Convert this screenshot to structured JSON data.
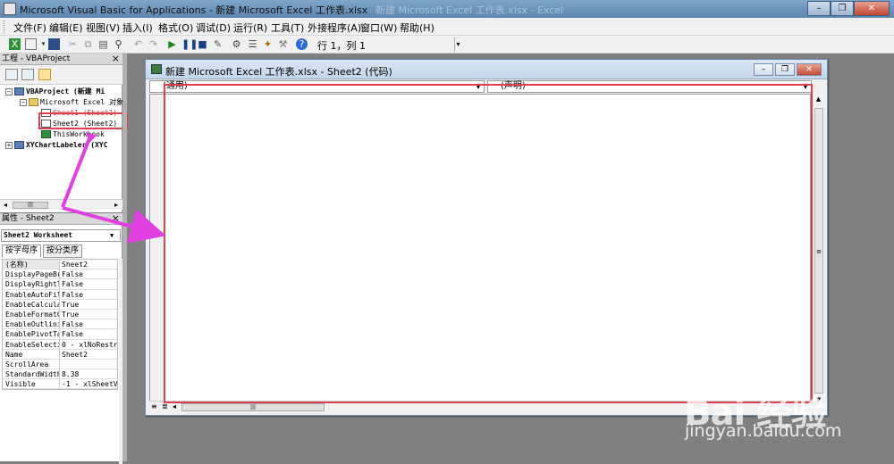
{
  "window": {
    "title": "Microsoft Visual Basic for Applications - 新建 Microsoft Excel 工作表.xlsx",
    "ghost_title": "新建 Microsoft Excel 工作表.xlsx - Excel"
  },
  "menubar": {
    "items": [
      "文件(F)",
      "编辑(E)",
      "视图(V)",
      "插入(I)",
      "格式(O)",
      "调试(D)",
      "运行(R)",
      "工具(T)",
      "外接程序(A)",
      "窗口(W)",
      "帮助(H)"
    ]
  },
  "toolbar": {
    "status": "行 1，列 1"
  },
  "project_pane": {
    "header": "工程 - VBAProject",
    "close": "×",
    "tree": [
      {
        "label": "VBAProject (新建 Mi",
        "bold": true
      },
      {
        "label": "Microsoft Excel 对象"
      },
      {
        "label": "Sheet1 (Sheet1)"
      },
      {
        "label": "Sheet2 (Sheet2)"
      },
      {
        "label": "ThisWorkbook"
      },
      {
        "label": "XYChartLabeler (XYC",
        "bold": true
      }
    ]
  },
  "properties_pane": {
    "header": "属性 - Sheet2",
    "close": "×",
    "object": "Sheet2 Worksheet",
    "tabs": [
      "按字母序",
      "按分类序"
    ],
    "rows": [
      {
        "key": "(名称)",
        "value": "Sheet2"
      },
      {
        "key": "DisplayPageBre",
        "value": "False"
      },
      {
        "key": "DisplayRightTo",
        "value": "False"
      },
      {
        "key": "EnableAutoFilt",
        "value": "False"
      },
      {
        "key": "EnableCalculat",
        "value": "True"
      },
      {
        "key": "EnableFormatCo",
        "value": "True"
      },
      {
        "key": "EnableOutlinin",
        "value": "False"
      },
      {
        "key": "EnablePivotTab",
        "value": "False"
      },
      {
        "key": "EnableSelectio",
        "value": "0 - xlNoRestr"
      },
      {
        "key": "Name",
        "value": "Sheet2"
      },
      {
        "key": "ScrollArea",
        "value": ""
      },
      {
        "key": "StandardWidth",
        "value": "8.38"
      },
      {
        "key": "Visible",
        "value": "-1 - xlSheetV"
      }
    ]
  },
  "code_window": {
    "title": "新建 Microsoft Excel 工作表.xlsx - Sheet2 (代码)",
    "object_combo": "(通用)",
    "proc_combo": "(声明)"
  },
  "watermark": {
    "logo": "Bai  经验",
    "url": "jingyan.baidu.com"
  },
  "colors": {
    "highlight": "#e04050",
    "arrow": "#e040e0"
  }
}
